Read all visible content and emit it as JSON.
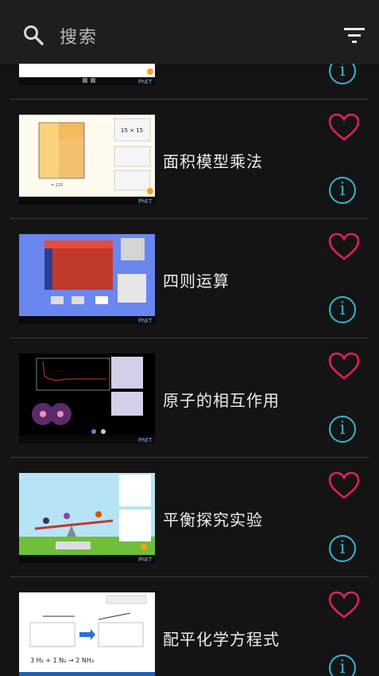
{
  "search": {
    "placeholder": "搜索",
    "icon": "search-icon"
  },
  "toolbar": {
    "filter_icon": "filter-icon"
  },
  "colors": {
    "background": "#141414",
    "topbar": "#1e1e1e",
    "heart": "#e0204f",
    "info": "#2fb8d6",
    "divider": "#3a3a3a"
  },
  "simulations": [
    {
      "title": ""
    },
    {
      "title": "面积模型乘法"
    },
    {
      "title": "四则运算"
    },
    {
      "title": "原子的相互作用"
    },
    {
      "title": "平衡探究实验"
    },
    {
      "title": "配平化学方程式"
    }
  ]
}
